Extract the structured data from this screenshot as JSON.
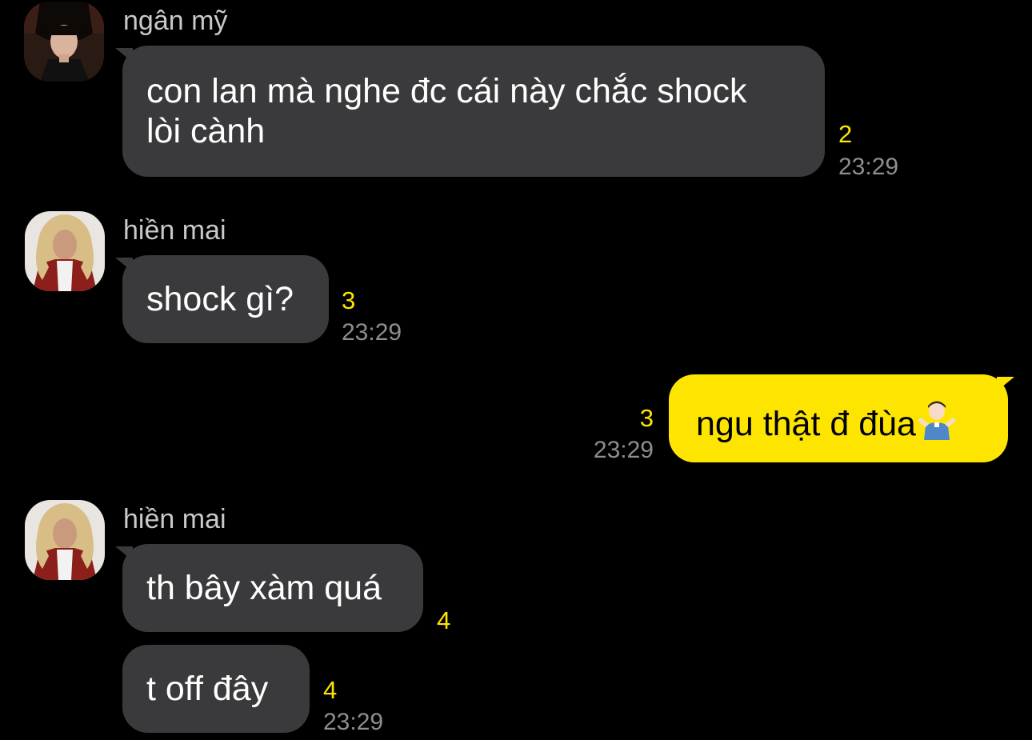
{
  "messages": [
    {
      "sender": "ngân mỹ",
      "lines": [
        "con lan mà nghe đc cái này chắc shock",
        "lòi cành"
      ],
      "unread": "2",
      "time": "23:29"
    },
    {
      "sender": "hiền mai",
      "lines": [
        "shock gì?"
      ],
      "unread": "3",
      "time": "23:29"
    },
    {
      "sender": "",
      "lines": [
        "ngu thật đ đùa"
      ],
      "emoji": "man-shrugging-emoji",
      "unread": "3",
      "time": "23:29"
    },
    {
      "sender": "hiền mai",
      "lines": [
        "th bây xàm quá"
      ],
      "unread": "4",
      "time": ""
    },
    {
      "sender": "",
      "lines": [
        "t off đây"
      ],
      "unread": "4",
      "time": "23:29"
    }
  ],
  "colors": {
    "background": "#000000",
    "received_bubble": "#3a3a3c",
    "sent_bubble": "#fee500",
    "unread_count": "#fee500",
    "timestamp": "#8e8e8e",
    "sender_name": "#c9c9c9"
  }
}
